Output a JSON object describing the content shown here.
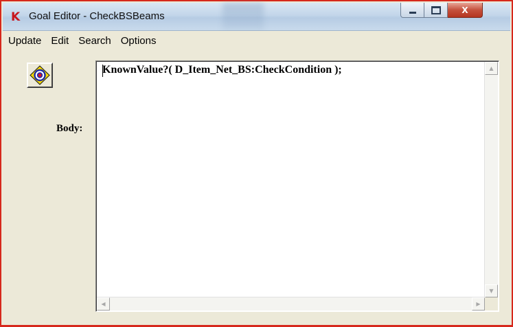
{
  "window": {
    "title": "Goal Editor - CheckBSBeams",
    "app_icon_letter": "K",
    "minimize_glyph": "",
    "maximize_glyph": "",
    "close_glyph": "X"
  },
  "menu": {
    "items": [
      "Update",
      "Edit",
      "Search",
      "Options"
    ]
  },
  "editor": {
    "label": "Body:",
    "text": "KnownValue?( D_Item_Net_BS:CheckCondition );"
  },
  "scrollbars": {
    "up_glyph": "▲",
    "down_glyph": "▼",
    "left_glyph": "◀",
    "right_glyph": "▶"
  },
  "colors": {
    "frame_border": "#d6281c",
    "window_bg": "#ece9d8",
    "target_ring_outer": "#f5d800",
    "target_ring_blue": "#1c2ca8",
    "target_center": "#d4142a"
  },
  "icons": [
    "app-k-icon",
    "target-goal-icon",
    "minimize-icon",
    "maximize-icon",
    "close-icon"
  ]
}
